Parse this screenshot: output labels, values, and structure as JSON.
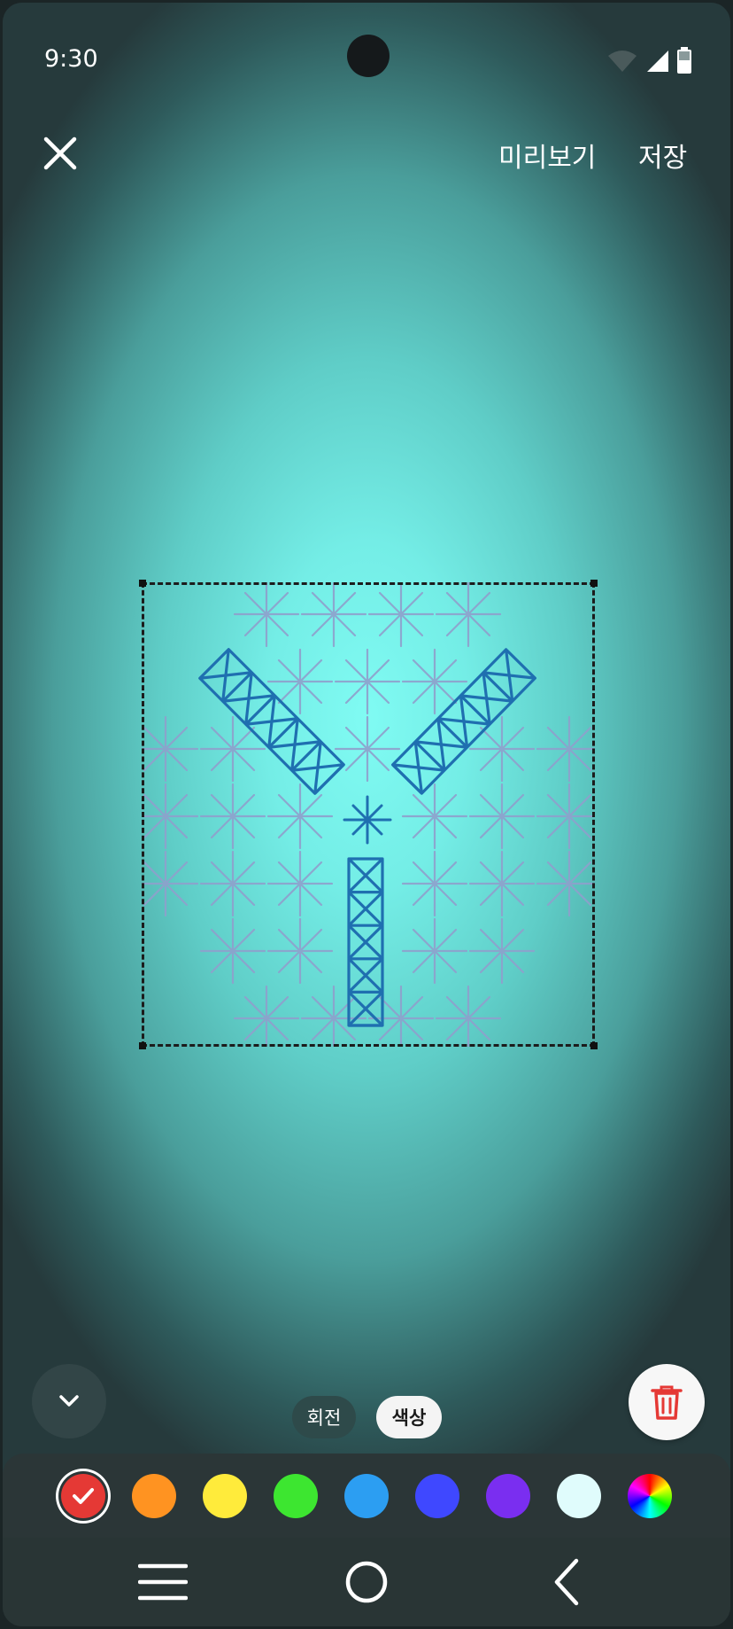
{
  "status_bar": {
    "time": "9:30",
    "icons": [
      "wifi-icon",
      "signal-icon",
      "battery-icon"
    ]
  },
  "top_bar": {
    "close_icon": "close-icon",
    "preview_label": "미리보기",
    "save_label": "저장"
  },
  "editor": {
    "sticker": "y-shaped-lattice-sticker",
    "selection_style": "dashed"
  },
  "toolbar": {
    "collapse_icon": "chevron-down-icon",
    "delete_icon": "trash-icon",
    "modes": [
      {
        "label": "회전",
        "selected": false
      },
      {
        "label": "색상",
        "selected": true
      }
    ]
  },
  "palette": {
    "colors": [
      {
        "name": "red",
        "hex": "#e53935",
        "selected": true
      },
      {
        "name": "orange",
        "hex": "#ff9321"
      },
      {
        "name": "yellow",
        "hex": "#ffeb3b"
      },
      {
        "name": "green",
        "hex": "#3de630"
      },
      {
        "name": "sky-blue",
        "hex": "#2c9ef2"
      },
      {
        "name": "blue",
        "hex": "#3f48ff"
      },
      {
        "name": "purple",
        "hex": "#7a2ef0"
      },
      {
        "name": "light-cyan",
        "hex": "#e0fcfc"
      },
      {
        "name": "spectrum",
        "hex": "conic-gradient"
      }
    ]
  },
  "nav_bar": {
    "items": [
      "recent-apps-icon",
      "home-icon",
      "back-icon"
    ]
  }
}
